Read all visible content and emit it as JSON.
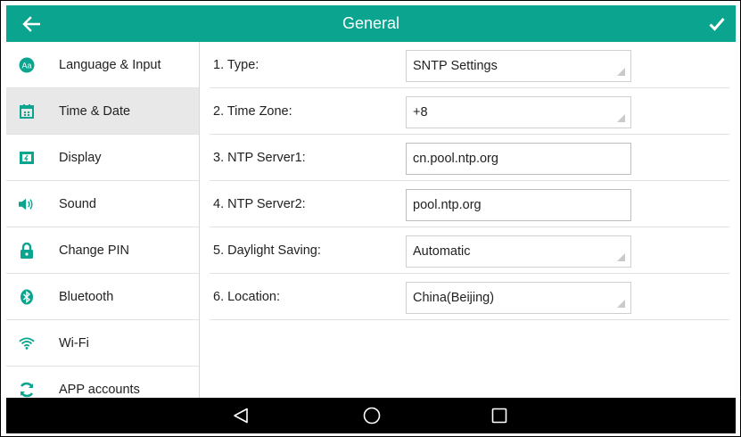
{
  "header": {
    "title": "General",
    "back_icon": "arrow-left-icon",
    "confirm_icon": "checkmark-icon",
    "color": "#0aa48f"
  },
  "sidebar": {
    "items": [
      {
        "label": "Language & Input",
        "icon": "language-icon",
        "active": false
      },
      {
        "label": "Time & Date",
        "icon": "calendar-icon",
        "active": true
      },
      {
        "label": "Display",
        "icon": "display-icon",
        "active": false
      },
      {
        "label": "Sound",
        "icon": "speaker-icon",
        "active": false
      },
      {
        "label": "Change PIN",
        "icon": "lock-icon",
        "active": false
      },
      {
        "label": "Bluetooth",
        "icon": "bluetooth-icon",
        "active": false
      },
      {
        "label": "Wi-Fi",
        "icon": "wifi-icon",
        "active": false
      },
      {
        "label": "APP accounts",
        "icon": "sync-icon",
        "active": false
      }
    ]
  },
  "settings": {
    "rows": [
      {
        "label": "1. Type:",
        "value": "SNTP Settings",
        "kind": "select"
      },
      {
        "label": "2. Time Zone:",
        "value": "+8",
        "kind": "select"
      },
      {
        "label": "3. NTP Server1:",
        "value": "cn.pool.ntp.org",
        "kind": "text"
      },
      {
        "label": "4. NTP Server2:",
        "value": "pool.ntp.org",
        "kind": "text"
      },
      {
        "label": "5. Daylight Saving:",
        "value": "Automatic",
        "kind": "select"
      },
      {
        "label": "6. Location:",
        "value": "China(Beijing)",
        "kind": "select"
      }
    ]
  },
  "navbar": {
    "back_icon": "triangle-back-icon",
    "home_icon": "circle-home-icon",
    "recent_icon": "square-recent-icon"
  }
}
